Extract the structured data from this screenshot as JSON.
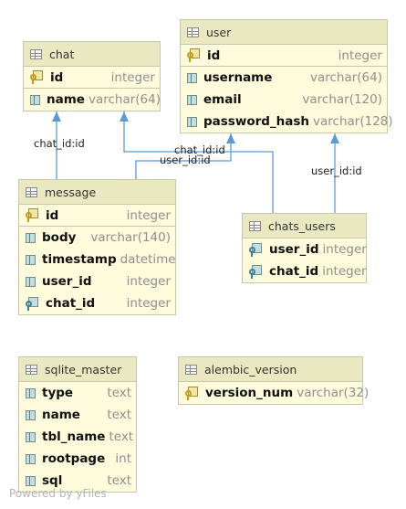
{
  "tables": [
    {
      "id": "chat",
      "name": "chat",
      "columns": [
        {
          "name": "id",
          "type": "integer",
          "key": "pk"
        },
        {
          "name": "name",
          "type": "varchar(64)",
          "key": ""
        }
      ]
    },
    {
      "id": "user",
      "name": "user",
      "columns": [
        {
          "name": "id",
          "type": "integer",
          "key": "pk"
        },
        {
          "name": "username",
          "type": "varchar(64)",
          "key": ""
        },
        {
          "name": "email",
          "type": "varchar(120)",
          "key": ""
        },
        {
          "name": "password_hash",
          "type": "varchar(128)",
          "key": ""
        }
      ]
    },
    {
      "id": "message",
      "name": "message",
      "columns": [
        {
          "name": "id",
          "type": "integer",
          "key": "pk"
        },
        {
          "name": "body",
          "type": "varchar(140)",
          "key": ""
        },
        {
          "name": "timestamp",
          "type": "datetime",
          "key": ""
        },
        {
          "name": "user_id",
          "type": "integer",
          "key": ""
        },
        {
          "name": "chat_id",
          "type": "integer",
          "key": "fk"
        }
      ]
    },
    {
      "id": "chats_users",
      "name": "chats_users",
      "columns": [
        {
          "name": "user_id",
          "type": "integer",
          "key": "fk"
        },
        {
          "name": "chat_id",
          "type": "integer",
          "key": "fk"
        }
      ]
    },
    {
      "id": "sqlite_master",
      "name": "sqlite_master",
      "columns": [
        {
          "name": "type",
          "type": "text",
          "key": ""
        },
        {
          "name": "name",
          "type": "text",
          "key": ""
        },
        {
          "name": "tbl_name",
          "type": "text",
          "key": ""
        },
        {
          "name": "rootpage",
          "type": "int",
          "key": ""
        },
        {
          "name": "sql",
          "type": "text",
          "key": ""
        }
      ]
    },
    {
      "id": "alembic_version",
      "name": "alembic_version",
      "columns": [
        {
          "name": "version_num",
          "type": "varchar(32)",
          "key": "pk"
        }
      ]
    }
  ],
  "relations": [
    {
      "id": "message-chat",
      "from": "message",
      "to": "chat",
      "label": "chat_id:id"
    },
    {
      "id": "message-user",
      "from": "message",
      "to": "user",
      "label": "user_id:id"
    },
    {
      "id": "chats_users-chat",
      "from": "chats_users",
      "to": "chat",
      "label": "chat_id:id"
    },
    {
      "id": "chats_users-user",
      "from": "chats_users",
      "to": "user",
      "label": "user_id:id"
    }
  ],
  "colors": {
    "edge": "#5b9bd5",
    "header": "#e9e8c0",
    "body": "#fdfbdb",
    "border": "#c8c8a8"
  },
  "watermark": "Powered by yFiles"
}
